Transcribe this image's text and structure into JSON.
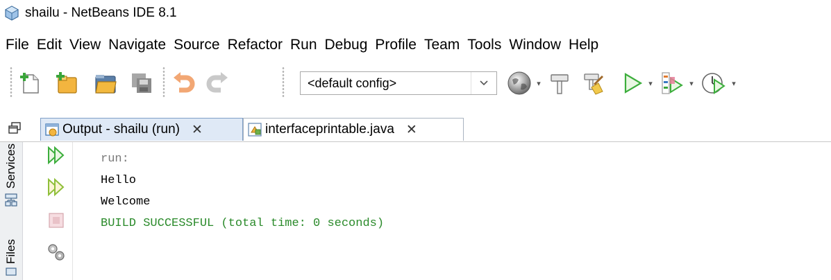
{
  "window": {
    "title": "shailu - NetBeans IDE 8.1",
    "app_icon": "netbeans-cube-icon"
  },
  "menu": [
    "File",
    "Edit",
    "View",
    "Navigate",
    "Source",
    "Refactor",
    "Run",
    "Debug",
    "Profile",
    "Team",
    "Tools",
    "Window",
    "Help"
  ],
  "toolbar": {
    "buttons": [
      "new-file-icon",
      "new-project-icon",
      "open-project-icon",
      "save-all-icon",
      "undo-icon",
      "redo-icon",
      "browser-globe-icon",
      "build-hammer-icon",
      "clean-build-icon",
      "run-project-icon",
      "debug-project-icon",
      "profile-project-icon"
    ],
    "config_value": "<default config>"
  },
  "tabs": [
    {
      "label": "Output - shailu (run)",
      "icon": "output-window-icon",
      "active": true
    },
    {
      "label": "interfaceprintable.java",
      "icon": "java-file-icon",
      "active": false
    }
  ],
  "sidebar": {
    "services_label": "Services",
    "files_label": "Files"
  },
  "output_controls": [
    "rerun-icon",
    "rerun-with-params-icon",
    "stop-icon",
    "settings-icon"
  ],
  "console": {
    "lines": [
      {
        "text": "run:",
        "kind": "run"
      },
      {
        "text": "Hello",
        "kind": "normal"
      },
      {
        "text": "Welcome",
        "kind": "normal"
      },
      {
        "text": "BUILD SUCCESSFUL (total time: 0 seconds)",
        "kind": "success"
      }
    ]
  },
  "colors": {
    "success": "#2a8a2a",
    "run_text": "#7a7a7a",
    "run_icon": "#3cae3c",
    "active_tab": "#dfe9f6"
  }
}
